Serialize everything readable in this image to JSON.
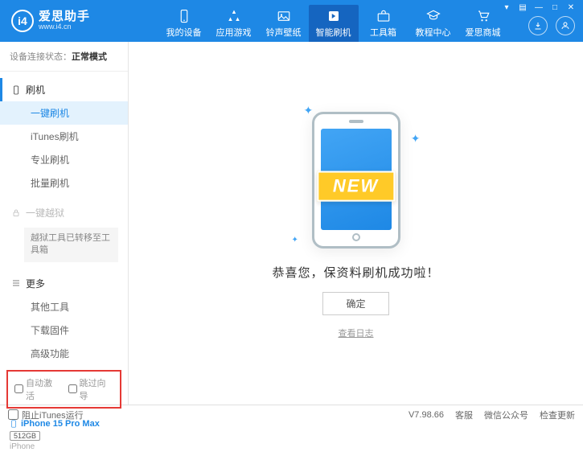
{
  "app": {
    "title": "爱思助手",
    "url": "www.i4.cn"
  },
  "nav": {
    "items": [
      {
        "label": "我的设备"
      },
      {
        "label": "应用游戏"
      },
      {
        "label": "铃声壁纸"
      },
      {
        "label": "智能刷机"
      },
      {
        "label": "工具箱"
      },
      {
        "label": "教程中心"
      },
      {
        "label": "爱思商城"
      }
    ]
  },
  "sidebar": {
    "status_label": "设备连接状态：",
    "status_value": "正常模式",
    "flash_header": "刷机",
    "flash_items": {
      "one_key": "一键刷机",
      "itunes": "iTunes刷机",
      "pro": "专业刷机",
      "batch": "批量刷机"
    },
    "jailbreak_header": "一键越狱",
    "jailbreak_note": "越狱工具已转移至工具箱",
    "more_header": "更多",
    "more_items": {
      "other_tools": "其他工具",
      "download_fw": "下载固件",
      "advanced": "高级功能"
    },
    "checkboxes": {
      "auto_activate": "自动激活",
      "skip_guide": "跳过向导"
    },
    "device": {
      "name": "iPhone 15 Pro Max",
      "storage": "512GB",
      "type": "iPhone"
    }
  },
  "main": {
    "ribbon": "NEW",
    "success_msg": "恭喜您，保资料刷机成功啦！",
    "ok_button": "确定",
    "log_link": "查看日志"
  },
  "statusbar": {
    "block_itunes": "阻止iTunes运行",
    "version": "V7.98.66",
    "support": "客服",
    "wechat": "微信公众号",
    "update": "检查更新"
  }
}
